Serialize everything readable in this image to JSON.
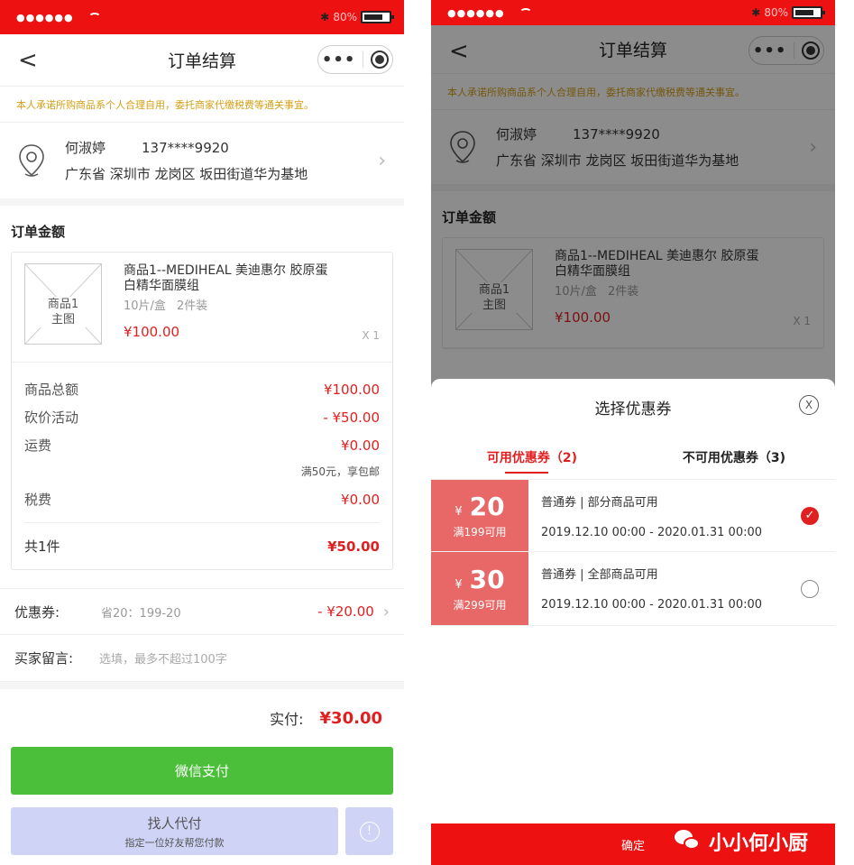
{
  "status": {
    "signal": "●●●●●●",
    "battery": "80%"
  },
  "nav": {
    "title": "订单结算",
    "back": "<"
  },
  "notice": "本人承诺所购商品系个人合理自用，委托商家代缴税费等通关事宜。",
  "address": {
    "name": "何淑婷",
    "phone": "137****9920",
    "detail": "广东省 深圳市 龙岗区 坂田街道华为基地"
  },
  "order": {
    "section_title": "订单金额",
    "product": {
      "thumb_label": "商品1\n主图",
      "name": "商品1--MEDIHEAL 美迪惠尔 胶原蛋白精华面膜组",
      "spec": "10片/盒",
      "pack": "2件装",
      "price": "¥100.00",
      "qty": "X 1"
    },
    "fees": [
      {
        "label": "商品总额",
        "value": "¥100.00"
      },
      {
        "label": "砍价活动",
        "value": "- ¥50.00"
      },
      {
        "label": "运费",
        "value": "¥0.00"
      }
    ],
    "shipping_note": "满50元，享包邮",
    "tax": {
      "label": "税费",
      "value": "¥0.00"
    },
    "total": {
      "label": "共1件",
      "value": "¥50.00"
    }
  },
  "coupon_row": {
    "label": "优惠券:",
    "desc": "省20：199-20",
    "value": "- ¥20.00"
  },
  "message_row": {
    "label": "买家留言:",
    "placeholder": "选填，最多不超过100字"
  },
  "pay": {
    "label": "实付:",
    "value": "¥30.00"
  },
  "buttons": {
    "wechat": "微信支付",
    "friend": "找人代付",
    "friend_sub": "指定一位好友帮您付款",
    "info": "!"
  },
  "sheet": {
    "title": "选择优惠券",
    "close": "X",
    "tabs": [
      {
        "label": "可用优惠券（2)"
      },
      {
        "label": "不可用优惠券（3)"
      }
    ],
    "coupons": [
      {
        "currency": "¥",
        "amount": "20",
        "condition": "满199可用",
        "type": "普通券 | 部分商品可用",
        "date": "2019.12.10 00:00 - 2020.01.31 00:00",
        "selected": true
      },
      {
        "currency": "¥",
        "amount": "30",
        "condition": "满299可用",
        "type": "普通券 | 全部商品可用",
        "date": "2019.12.10 00:00 - 2020.01.31 00:00",
        "selected": false
      }
    ],
    "confirm": "确定",
    "watermark": "小小何小厨"
  },
  "colors": {
    "accent": "#e02020",
    "statusbar": "#ee1111",
    "wechat": "#4cbf3a",
    "coupon": "#e86868"
  }
}
